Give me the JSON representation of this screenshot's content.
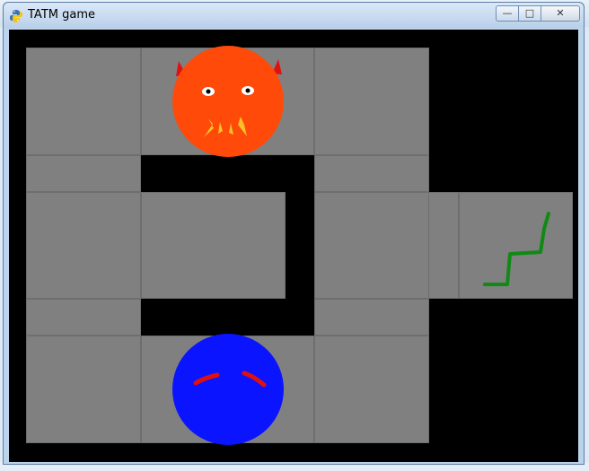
{
  "window": {
    "title": "TATM game",
    "controls": {
      "minimize": "—",
      "maximize": "□",
      "close": "✕"
    }
  },
  "game": {
    "characters": [
      {
        "name": "devil-enemy",
        "color": "#ff4a0a",
        "horn_color": "#e01010"
      },
      {
        "name": "blue-player",
        "color": "#0a14ff",
        "eyebrow_color": "#e01010"
      }
    ],
    "goal": {
      "name": "snake-goal",
      "color": "#0f8a14"
    },
    "colors": {
      "wall": "#000000",
      "floor": "#808080"
    }
  }
}
